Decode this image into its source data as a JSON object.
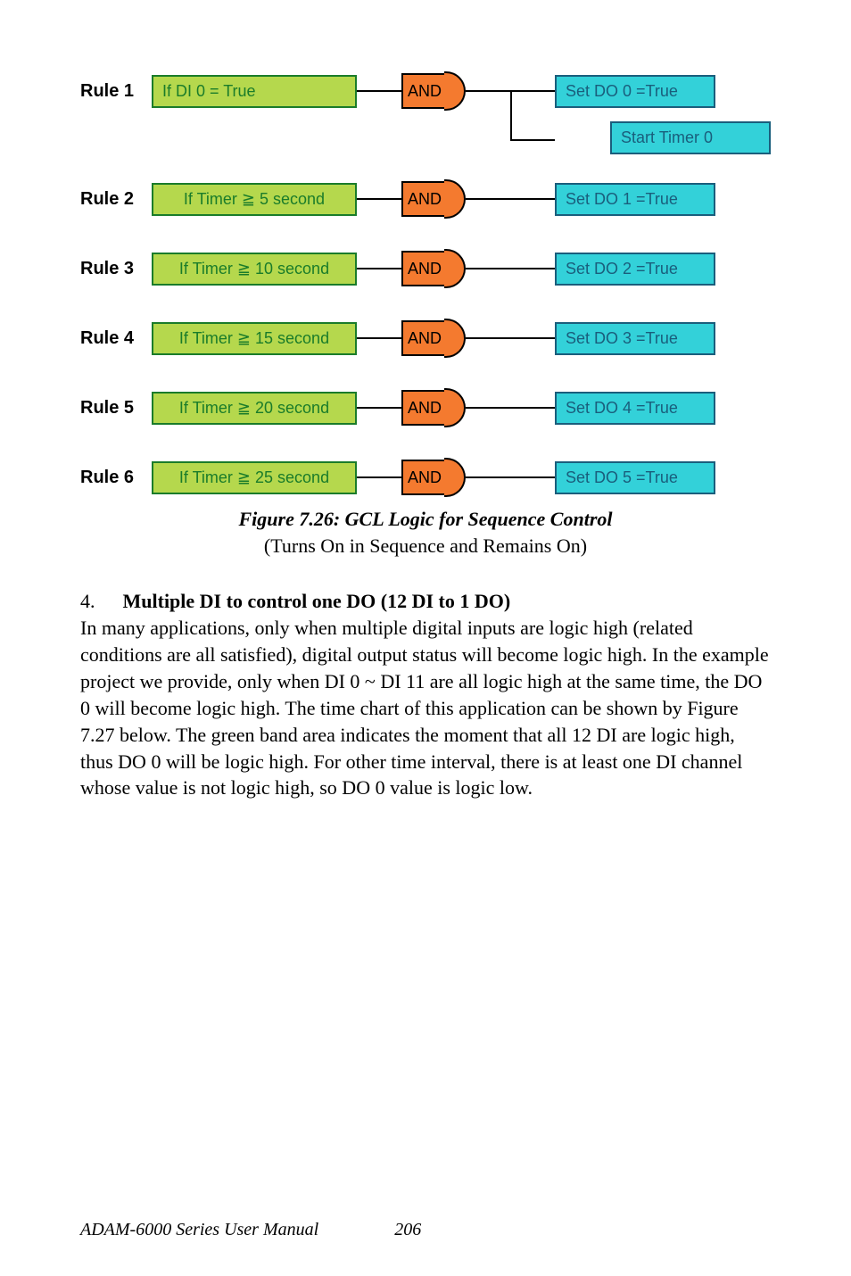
{
  "rules": [
    {
      "label": "Rule 1",
      "cond": "If DI 0 = True",
      "gate": "AND",
      "out": "Set DO 0 =True",
      "extra_out": "Start Timer 0"
    },
    {
      "label": "Rule 2",
      "cond": "If Timer ≧ 5 second",
      "gate": "AND",
      "out": "Set DO 1 =True"
    },
    {
      "label": "Rule 3",
      "cond": "If Timer ≧ 10 second",
      "gate": "AND",
      "out": "Set DO 2 =True"
    },
    {
      "label": "Rule 4",
      "cond": "If Timer ≧ 15 second",
      "gate": "AND",
      "out": "Set DO 3 =True"
    },
    {
      "label": "Rule 5",
      "cond": "If Timer ≧ 20 second",
      "gate": "AND",
      "out": "Set DO 4 =True"
    },
    {
      "label": "Rule 6",
      "cond": "If Timer ≧ 25 second",
      "gate": "AND",
      "out": "Set DO 5 =True"
    }
  ],
  "figure": {
    "caption": "Figure 7.26: GCL Logic for Sequence Control",
    "subcaption": "(Turns On in Sequence and Remains On)"
  },
  "section": {
    "number": "4.",
    "title": "Multiple DI to control one DO (12 DI to 1 DO)",
    "body": "In many applications, only when multiple digital inputs are logic high (related conditions are all satisfied), digital output status will become logic high. In the example project we provide, only when DI 0 ~ DI 11 are all logic high at the same time, the DO 0 will become logic high. The time chart of this application can be shown by Figure 7.27 below. The green band area indicates the moment that all 12 DI are logic high, thus DO 0 will be logic high. For other time interval, there is at least one DI channel whose value is not logic high, so DO 0 value is logic low."
  },
  "footer": {
    "manual": "ADAM-6000 Series User Manual",
    "page": "206"
  }
}
